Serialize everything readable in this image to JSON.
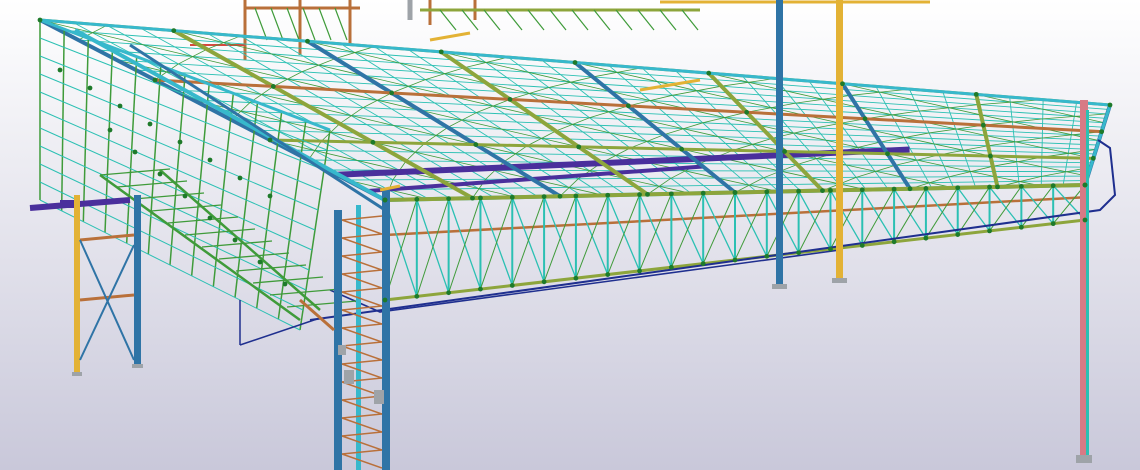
{
  "viewport": {
    "background_top": "#ffffff",
    "background_bottom": "#c9c8da",
    "object": "steel-structure-3d-model"
  },
  "colors": {
    "column_blue": "#2f74a6",
    "column_orange": "#e3b235",
    "column_pink": "#d77a85",
    "beam_cyan": "#37b8cc",
    "beam_olive": "#8da53c",
    "beam_rust": "#b9703a",
    "bracing_teal": "#2bc0b3",
    "bracing_green": "#3f9b3a",
    "purple_member": "#4a2f9c",
    "navy_outline": "#1f2f8f",
    "red_detail": "#d6493f",
    "node_marker": "#1e7a2a",
    "grey_plate": "#9ea3a8"
  }
}
